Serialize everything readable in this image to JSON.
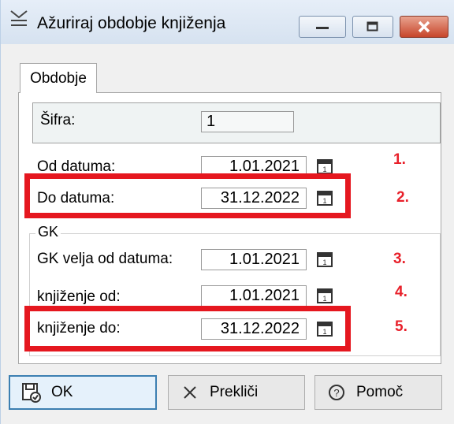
{
  "window": {
    "title": "Ažuriraj obdobje knjiženja",
    "title_icon": "period-edit-icon",
    "controls": [
      "minimize-icon",
      "maximize-icon",
      "close-icon"
    ]
  },
  "tabs": [
    {
      "label": "Obdobje",
      "selected": true
    }
  ],
  "form": {
    "sifra": {
      "label": "Šifra:",
      "value": "1"
    },
    "od_datuma": {
      "label": "Od datuma:",
      "value": "1.01.2021",
      "marker": "1."
    },
    "do_datuma": {
      "label": "Do datuma:",
      "value": "31.12.2022",
      "marker": "2."
    },
    "gk_group": {
      "title": "GK",
      "velja_od": {
        "label": "GK velja od datuma:",
        "value": "1.01.2021",
        "marker": "3."
      },
      "knjizenje_od": {
        "label": "knjiženje od:",
        "value": "1.01.2021",
        "marker": "4."
      },
      "knjizenje_do": {
        "label": "knjiženje do:",
        "value": "31.12.2022",
        "marker": "5."
      }
    }
  },
  "buttons": {
    "ok": {
      "label": "OK",
      "icon": "save-check-icon"
    },
    "cancel": {
      "label": "Prekliči",
      "icon": "x-icon"
    },
    "help": {
      "label": "Pomoč",
      "icon": "help-icon"
    }
  },
  "colors": {
    "highlight": "#e5171f",
    "marker_text": "#e8202a",
    "focus_border": "#3c7fb1"
  }
}
